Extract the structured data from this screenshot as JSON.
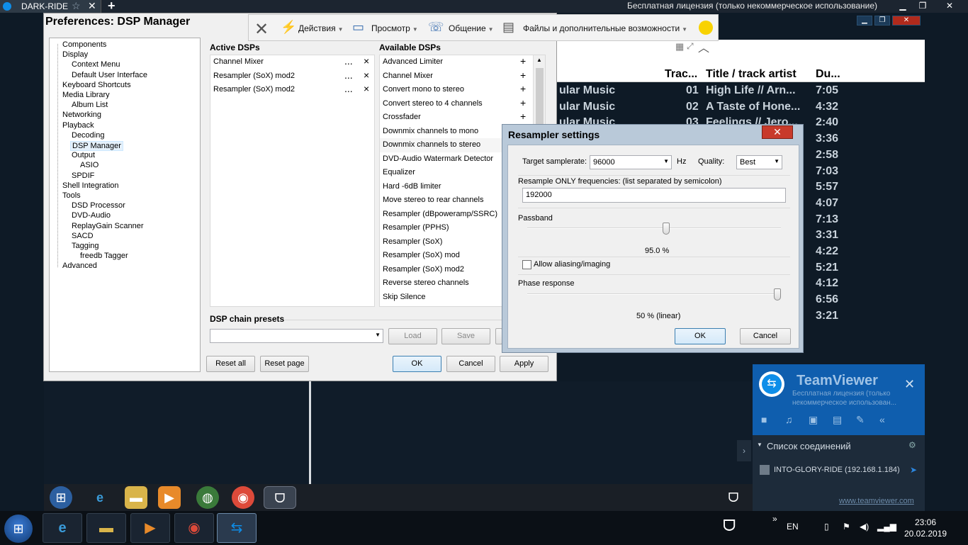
{
  "remote_bar": {
    "tab_name": "DARK-RIDE",
    "license": "Бесплатная лицензия (только некоммерческое использование)"
  },
  "teamviewer_toolbar": {
    "menus": [
      {
        "label": "Действия",
        "icon": "lightning-icon"
      },
      {
        "label": "Просмотр",
        "icon": "monitor-icon"
      },
      {
        "label": "Общение",
        "icon": "chat-icon"
      },
      {
        "label": "Файлы и дополнительные возможности",
        "icon": "files-icon"
      }
    ]
  },
  "prefs": {
    "title": "Preferences: DSP Manager",
    "tree": [
      {
        "label": "Components",
        "level": 0
      },
      {
        "label": "Display",
        "level": 0
      },
      {
        "label": "Context Menu",
        "level": 1
      },
      {
        "label": "Default User Interface",
        "level": 1
      },
      {
        "label": "Keyboard Shortcuts",
        "level": 0
      },
      {
        "label": "Media Library",
        "level": 0
      },
      {
        "label": "Album List",
        "level": 1
      },
      {
        "label": "Networking",
        "level": 0
      },
      {
        "label": "Playback",
        "level": 0
      },
      {
        "label": "Decoding",
        "level": 1
      },
      {
        "label": "DSP Manager",
        "level": 1,
        "selected": true
      },
      {
        "label": "Output",
        "level": 1
      },
      {
        "label": "ASIO",
        "level": 2
      },
      {
        "label": "SPDIF",
        "level": 1
      },
      {
        "label": "Shell Integration",
        "level": 0
      },
      {
        "label": "Tools",
        "level": 0
      },
      {
        "label": "DSD Processor",
        "level": 1
      },
      {
        "label": "DVD-Audio",
        "level": 1
      },
      {
        "label": "ReplayGain Scanner",
        "level": 1
      },
      {
        "label": "SACD",
        "level": 1
      },
      {
        "label": "Tagging",
        "level": 1
      },
      {
        "label": "freedb Tagger",
        "level": 2
      },
      {
        "label": "Advanced",
        "level": 0
      }
    ],
    "active_label": "Active DSPs",
    "active_dsps": [
      "Channel Mixer",
      "Resampler (SoX) mod2",
      "Resampler (SoX) mod2"
    ],
    "configure_glyph": "...",
    "remove_glyph": "×",
    "available_label": "Available DSPs",
    "add_glyph": "+",
    "available_dsps": [
      "Advanced Limiter",
      "Channel Mixer",
      "Convert mono to stereo",
      "Convert stereo to 4 channels",
      "Crossfader",
      "Downmix channels to mono",
      "Downmix channels to stereo",
      "DVD-Audio Watermark Detector",
      "Equalizer",
      "Hard -6dB limiter",
      "Move stereo to rear channels",
      "Resampler (dBpoweramp/SSRC)",
      "Resampler (PPHS)",
      "Resampler (SoX)",
      "Resampler (SoX) mod",
      "Resampler (SoX) mod2",
      "Reverse stereo channels",
      "Skip Silence"
    ],
    "presets_label": "DSP chain presets",
    "load": "Load",
    "save": "Save",
    "reset_all": "Reset all",
    "reset_page": "Reset page",
    "ok": "OK",
    "cancel": "Cancel",
    "apply": "Apply"
  },
  "playlist": {
    "col_track": "Trac...",
    "col_title": "Title / track artist",
    "col_duration": "Du...",
    "rows": [
      {
        "album": "ular Music",
        "no": "01",
        "title": "High Life // Arn...",
        "dur": "7:05"
      },
      {
        "album": "ular Music",
        "no": "02",
        "title": "A Taste of Hone...",
        "dur": "4:32"
      },
      {
        "album": "ular Music",
        "no": "03",
        "title": "Feelings // Jero...",
        "dur": "2:40"
      },
      {
        "album": "",
        "no": "",
        "title": "",
        "dur": "3:36"
      },
      {
        "album": "",
        "no": "",
        "title": "",
        "dur": "2:58"
      },
      {
        "album": "",
        "no": "",
        "title": "",
        "dur": "7:03"
      },
      {
        "album": "",
        "no": "",
        "title": "",
        "dur": "5:57"
      },
      {
        "album": "",
        "no": "",
        "title": "",
        "dur": "4:07"
      },
      {
        "album": "",
        "no": "",
        "title": "",
        "dur": "7:13"
      },
      {
        "album": "",
        "no": "",
        "title": "",
        "dur": "3:31"
      },
      {
        "album": "",
        "no": "",
        "title": "",
        "dur": "4:22"
      },
      {
        "album": "",
        "no": "",
        "title": "",
        "dur": "5:21"
      },
      {
        "album": "",
        "no": "",
        "title": "",
        "dur": "4:12"
      },
      {
        "album": "",
        "no": "",
        "title": "",
        "dur": "6:56"
      },
      {
        "album": "",
        "no": "",
        "title": "",
        "dur": "3:21"
      }
    ]
  },
  "resampler": {
    "title": "Resampler settings",
    "target_label": "Target samplerate:",
    "target_value": "96000",
    "hz": "Hz",
    "quality_label": "Quality:",
    "quality_value": "Best",
    "only_label": "Resample ONLY frequencies: (list separated by semicolon)",
    "only_value": "192000",
    "passband_label": "Passband",
    "passband_value": "95.0 %",
    "passband_level": 0.55,
    "aliasing_label": "Allow aliasing/imaging",
    "aliasing_checked": false,
    "phase_label": "Phase response",
    "phase_value": "50 % (linear)",
    "phase_level": 1.0,
    "ok": "OK",
    "cancel": "Cancel"
  },
  "teamviewer_panel": {
    "name": "TeamViewer",
    "desc": "Бесплатная лицензия (только некоммерческое использован...",
    "list_title": "Список соединений",
    "entry": "INTO-GLORY-RIDE (192.168.1.184)",
    "link": "www.teamviewer.com"
  },
  "tray": {
    "lang": "EN",
    "time": "23:06",
    "date": "20.02.2019"
  }
}
